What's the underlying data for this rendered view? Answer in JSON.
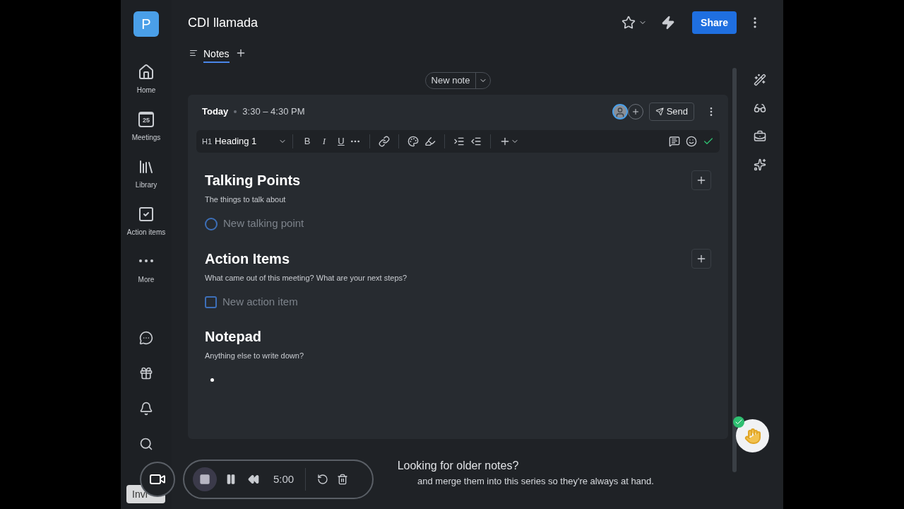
{
  "app_logo": "P",
  "title": "CDI llamada",
  "share_button": "Share",
  "tabs": [
    {
      "label": "Notes",
      "selected": true
    }
  ],
  "sidebar": {
    "items": [
      {
        "label": "Home",
        "kind": "home"
      },
      {
        "label": "Meetings",
        "kind": "calendar",
        "badge": "25"
      },
      {
        "label": "Library",
        "kind": "library"
      },
      {
        "label": "Action items",
        "kind": "check"
      },
      {
        "label": "More",
        "kind": "more"
      }
    ]
  },
  "new_note_button": "New note",
  "note": {
    "date": "Today",
    "time": "3:30 – 4:30 PM",
    "send_button": "Send",
    "toolbar": {
      "block_prefix": "H1",
      "block_style": "Heading 1",
      "bold": "B",
      "italic": "I",
      "underline": "U"
    },
    "sections": [
      {
        "title": "Talking Points",
        "description": "The things to talk about",
        "kind": "talking_point",
        "placeholder": "New talking point",
        "checked": false
      },
      {
        "title": "Action Items",
        "description": "What came out of this meeting? What are your next steps?",
        "kind": "action_item",
        "placeholder": "New action item",
        "checked": false
      },
      {
        "title": "Notepad",
        "description": "Anything else to write down?",
        "kind": "bullet"
      }
    ]
  },
  "older_notes": {
    "title": "Looking for older notes?",
    "text": "and merge them into this series so they're always at hand."
  },
  "recorder": {
    "time": "5:00"
  },
  "invite_button": "Invi"
}
